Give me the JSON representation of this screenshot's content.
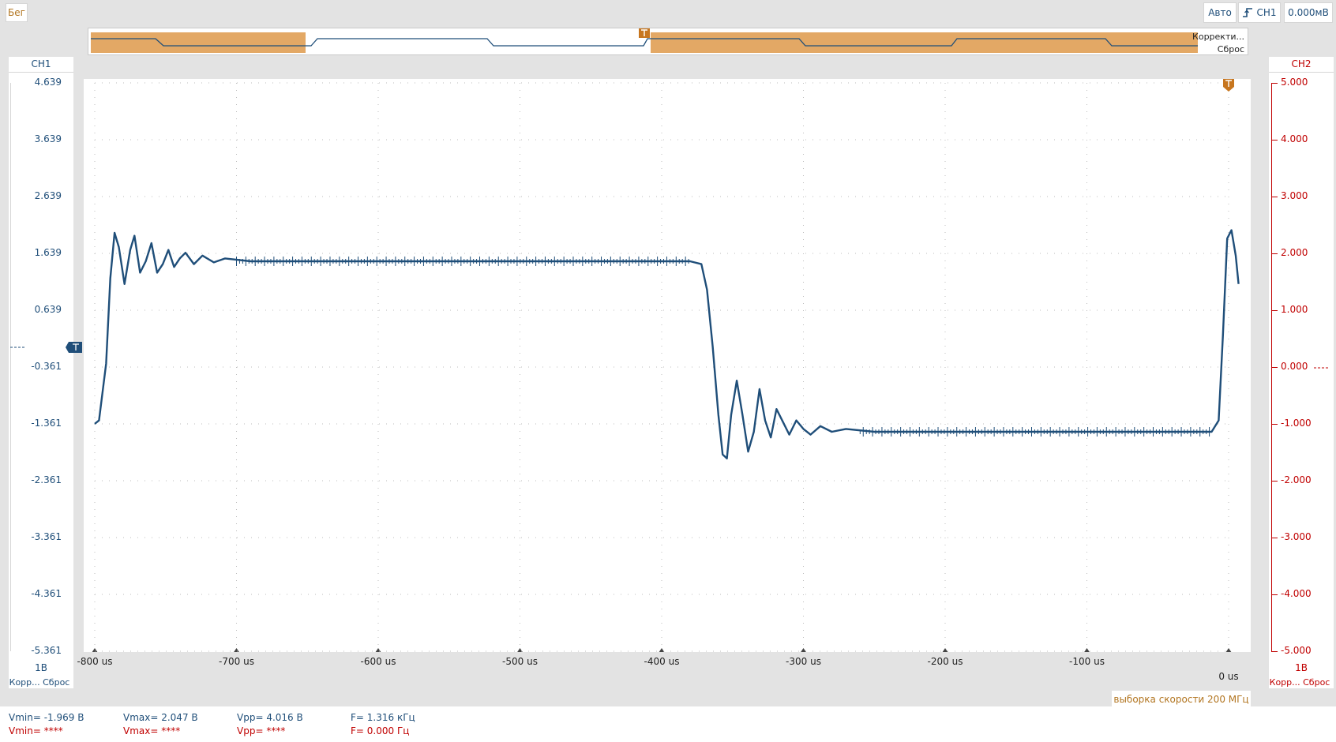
{
  "toolbar": {
    "run_label": "Бег",
    "mode_label": "Авто",
    "trigger_source_label": "CH1",
    "trigger_level_label": "0.000мВ"
  },
  "overview": {
    "correction_label": "Корректи...",
    "reset_label": "Сброс"
  },
  "left_panel": {
    "title": "CH1",
    "scale": "1В",
    "bottom_label": "Корр... Сброс",
    "ticks": [
      "4.639",
      "3.639",
      "2.639",
      "1.639",
      "0.639",
      "-0.361",
      "-1.361",
      "-2.361",
      "-3.361",
      "-4.361",
      "-5.361"
    ]
  },
  "right_panel": {
    "title": "CH2",
    "scale": "1В",
    "bottom_label": "Корр... Сброс",
    "ticks": [
      "5.000",
      "4.000",
      "3.000",
      "2.000",
      "1.000",
      "0.000",
      "-1.000",
      "-2.000",
      "-3.000",
      "-4.000",
      "-5.000"
    ]
  },
  "x_axis": {
    "ticks": [
      "-800 us",
      "-700 us",
      "-600 us",
      "-500 us",
      "-400 us",
      "-300 us",
      "-200 us",
      "-100 us"
    ],
    "zero_label": "0 us"
  },
  "sample_rate_label": "выборка скорости 200 МГц",
  "measurements": {
    "ch1": {
      "vmin": "Vmin= -1.969 В",
      "vmax": "Vmax= 2.047 В",
      "vpp": "Vpp= 4.016 В",
      "freq": "F= 1.316 кГц"
    },
    "ch2": {
      "vmin": "Vmin= ****",
      "vmax": "Vmax= ****",
      "vpp": "Vpp= ****",
      "freq": "F= 0.000 Гц"
    }
  },
  "colors": {
    "ch1": "#1f4e79",
    "ch2": "#c00000",
    "accent": "#b27520",
    "overview_fill": "#e3a865"
  },
  "chart_data": {
    "type": "line",
    "title": "",
    "xlabel": "",
    "ylabel": "",
    "x_unit": "us",
    "xlim": [
      -800,
      0
    ],
    "ylim": [
      -5.361,
      4.639
    ],
    "grid": true,
    "series": [
      {
        "name": "CH1",
        "high_level": 1.5,
        "low_level": -1.5,
        "peak": 2.047,
        "trough": -1.969,
        "points": [
          [
            -800,
            -1.36
          ],
          [
            -797,
            -1.3
          ],
          [
            -792,
            -0.3
          ],
          [
            -789,
            1.2
          ],
          [
            -786,
            2.0
          ],
          [
            -783,
            1.75
          ],
          [
            -779,
            1.1
          ],
          [
            -775,
            1.7
          ],
          [
            -772,
            1.95
          ],
          [
            -768,
            1.3
          ],
          [
            -764,
            1.5
          ],
          [
            -760,
            1.82
          ],
          [
            -756,
            1.3
          ],
          [
            -752,
            1.45
          ],
          [
            -748,
            1.7
          ],
          [
            -744,
            1.4
          ],
          [
            -740,
            1.55
          ],
          [
            -736,
            1.65
          ],
          [
            -730,
            1.45
          ],
          [
            -724,
            1.6
          ],
          [
            -716,
            1.48
          ],
          [
            -708,
            1.55
          ],
          [
            -690,
            1.5
          ],
          [
            -600,
            1.5
          ],
          [
            -500,
            1.5
          ],
          [
            -380,
            1.5
          ],
          [
            -372,
            1.45
          ],
          [
            -368,
            1.0
          ],
          [
            -364,
            0.0
          ],
          [
            -360,
            -1.2
          ],
          [
            -357,
            -1.9
          ],
          [
            -354,
            -1.97
          ],
          [
            -351,
            -1.2
          ],
          [
            -347,
            -0.6
          ],
          [
            -343,
            -1.2
          ],
          [
            -339,
            -1.85
          ],
          [
            -335,
            -1.5
          ],
          [
            -331,
            -0.75
          ],
          [
            -327,
            -1.3
          ],
          [
            -323,
            -1.6
          ],
          [
            -319,
            -1.1
          ],
          [
            -314,
            -1.35
          ],
          [
            -310,
            -1.55
          ],
          [
            -305,
            -1.3
          ],
          [
            -300,
            -1.45
          ],
          [
            -295,
            -1.55
          ],
          [
            -288,
            -1.4
          ],
          [
            -280,
            -1.5
          ],
          [
            -270,
            -1.45
          ],
          [
            -250,
            -1.5
          ],
          [
            -100,
            -1.5
          ],
          [
            -12,
            -1.5
          ],
          [
            -7,
            -1.3
          ],
          [
            -4,
            0.2
          ],
          [
            -1,
            1.9
          ],
          [
            2,
            2.047
          ],
          [
            5,
            1.6
          ],
          [
            7,
            1.1
          ]
        ]
      }
    ]
  }
}
